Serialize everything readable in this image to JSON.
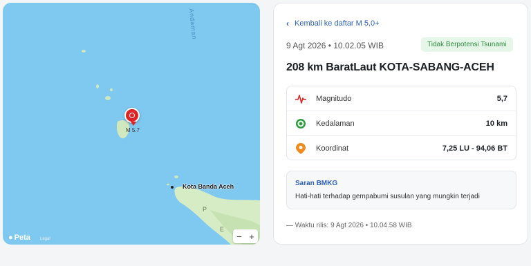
{
  "map": {
    "sea_label": "Andaman",
    "marker_label": "M 5.7",
    "city_label": "Kota Banda Aceh",
    "brand": "Peta",
    "legal": "Legal",
    "zoom_out": "−",
    "zoom_in": "+",
    "colors": {
      "sea": "#7fc8f0",
      "land": "#d6ecc5",
      "marker": "#e02424"
    }
  },
  "panel": {
    "back_link": "Kembali ke daftar M 5,0+",
    "datetime": "9 Agt 2026 • 10.02.05 WIB",
    "tsunami_badge": "Tidak Berpotensi Tsunami",
    "title": "208 km BaratLaut KOTA-SABANG-ACEH",
    "stats": [
      {
        "icon": "pulse-icon",
        "label": "Magnitudo",
        "value": "5,7"
      },
      {
        "icon": "target-icon",
        "label": "Kedalaman",
        "value": "10 km"
      },
      {
        "icon": "location-pin-icon",
        "label": "Koordinat",
        "value": "7,25 LU - 94,06 BT"
      }
    ],
    "advice": {
      "title": "Saran BMKG",
      "text": "Hati-hati terhadap gempabumi susulan yang mungkin terjadi"
    },
    "release_time": "— Waktu rilis: 9 Agt 2026 • 10.04.58 WIB"
  }
}
